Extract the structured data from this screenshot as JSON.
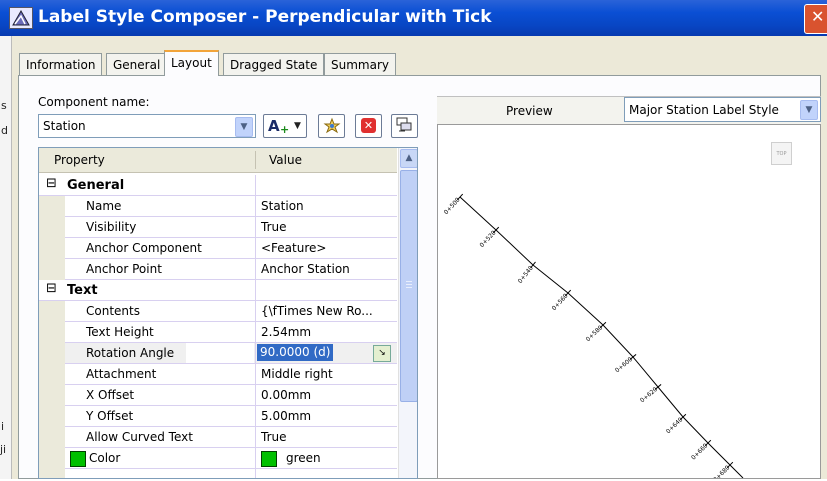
{
  "window": {
    "title": "Label Style Composer - Perpendicular with Tick"
  },
  "background_text": {
    "s": "s",
    "d": "d",
    "i": "i",
    "ji": "ji"
  },
  "tabs": [
    {
      "label": "Information"
    },
    {
      "label": "General"
    },
    {
      "label": "Layout",
      "active": true
    },
    {
      "label": "Dragged State"
    },
    {
      "label": "Summary"
    }
  ],
  "component": {
    "label": "Component name:",
    "value": "Station",
    "add_button_glyph": "A",
    "copy_icon": "copy-component-icon",
    "delete_icon": "delete-component-icon",
    "draw_order_icon": "draw-order-icon"
  },
  "grid": {
    "header": {
      "property": "Property",
      "value": "Value"
    },
    "categories": [
      {
        "name": "General",
        "expander": "⊟",
        "rows": [
          {
            "property": "Name",
            "value": "Station"
          },
          {
            "property": "Visibility",
            "value": "True"
          },
          {
            "property": "Anchor Component",
            "value": "<Feature>"
          },
          {
            "property": "Anchor Point",
            "value": "Anchor Station"
          }
        ]
      },
      {
        "name": "Text",
        "expander": "⊟",
        "rows": [
          {
            "property": "Contents",
            "value": "{\\fTimes New Ro..."
          },
          {
            "property": "Text Height",
            "value": "2.54mm"
          },
          {
            "property": "Rotation Angle",
            "value": "90.0000 (d)",
            "selected": true
          },
          {
            "property": "Attachment",
            "value": "Middle right"
          },
          {
            "property": "X Offset",
            "value": "0.00mm"
          },
          {
            "property": "Y Offset",
            "value": "5.00mm"
          },
          {
            "property": "Allow Curved Text",
            "value": "True"
          },
          {
            "property": "Color",
            "value": "green",
            "swatch": "#00c000"
          }
        ]
      }
    ]
  },
  "preview": {
    "label": "Preview",
    "style_value": "Major Station Label Style",
    "top_button": "TOP",
    "stations": [
      "0+500",
      "0+520",
      "0+540",
      "0+560",
      "0+580",
      "0+600",
      "0+620",
      "0+640",
      "0+660",
      "0+680"
    ]
  },
  "colors": {
    "title_bar": "#0a4fd4",
    "selection": "#316ac5",
    "swatch_green": "#00c000",
    "tab_accent": "#f2a43a"
  }
}
